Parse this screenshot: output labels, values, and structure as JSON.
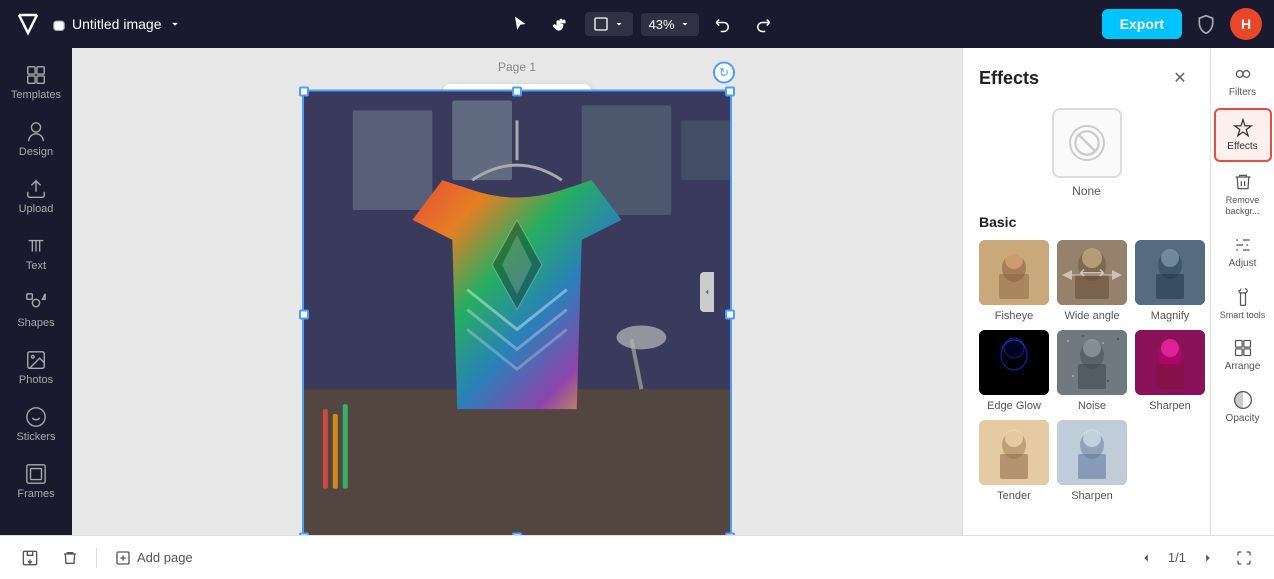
{
  "app": {
    "logo": "✕",
    "title": "Untitled image",
    "cloud_icon": "☁",
    "export_label": "Export",
    "avatar_label": "H"
  },
  "topbar": {
    "tools": [
      {
        "name": "select-tool",
        "icon": "▷"
      },
      {
        "name": "hand-tool",
        "icon": "✋"
      },
      {
        "name": "frame-tool",
        "icon": "⊞"
      },
      {
        "name": "more-tools",
        "icon": "···"
      }
    ],
    "zoom": "43%",
    "undo_icon": "↩",
    "redo_icon": "↪"
  },
  "sidebar": {
    "items": [
      {
        "name": "Templates",
        "label": "Templates"
      },
      {
        "name": "Design",
        "label": "Design"
      },
      {
        "name": "Upload",
        "label": "Upload"
      },
      {
        "name": "Text",
        "label": "Text"
      },
      {
        "name": "Shapes",
        "label": "Shapes"
      },
      {
        "name": "Photos",
        "label": "Photos"
      },
      {
        "name": "Stickers",
        "label": "Stickers"
      },
      {
        "name": "Frames",
        "label": "Frames"
      }
    ]
  },
  "canvas": {
    "page_label": "Page 1",
    "toolbar_buttons": [
      {
        "name": "crop",
        "icon": "⊡"
      },
      {
        "name": "grid",
        "icon": "⊞"
      },
      {
        "name": "copy",
        "icon": "❐"
      },
      {
        "name": "more",
        "icon": "···"
      }
    ]
  },
  "effects_panel": {
    "title": "Effects",
    "close_icon": "✕",
    "none_label": "None",
    "basic_section": "Basic",
    "effects": [
      {
        "name": "Fisheye",
        "thumb_class": "thumb-fisheye"
      },
      {
        "name": "Wide angle",
        "thumb_class": "thumb-wideangle"
      },
      {
        "name": "Magnify",
        "thumb_class": "thumb-magnify"
      },
      {
        "name": "Edge Glow",
        "thumb_class": "thumb-edgeglow"
      },
      {
        "name": "Noise",
        "thumb_class": "thumb-noise"
      },
      {
        "name": "Sharpen",
        "thumb_class": "thumb-sharpen"
      },
      {
        "name": "Tender",
        "thumb_class": "thumb-tender"
      },
      {
        "name": "Sharpen",
        "thumb_class": "thumb-sharpen2"
      }
    ]
  },
  "right_tools": [
    {
      "name": "Filters",
      "label": "Filters",
      "active": false
    },
    {
      "name": "Effects",
      "label": "Effects",
      "active": true
    },
    {
      "name": "Remove background",
      "label": "Remove\nbackgr...",
      "active": false
    },
    {
      "name": "Adjust",
      "label": "Adjust",
      "active": false
    },
    {
      "name": "Smart tools",
      "label": "Smart\ntools",
      "active": false
    },
    {
      "name": "Arrange",
      "label": "Arrange",
      "active": false
    },
    {
      "name": "Opacity",
      "label": "Opacity",
      "active": false
    }
  ],
  "bottom_bar": {
    "save_icon": "💾",
    "trash_icon": "🗑",
    "add_page_label": "Add page",
    "page_current": "1/1",
    "fullscreen_icon": "⤡"
  }
}
